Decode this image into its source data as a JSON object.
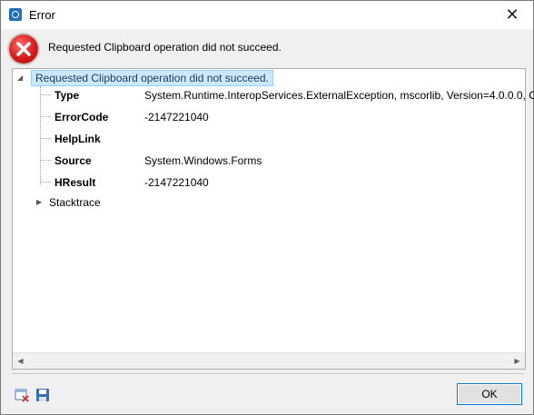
{
  "window": {
    "title": "Error",
    "close_glyph": "✕"
  },
  "error": {
    "icon": "error-icon",
    "message": "Requested Clipboard operation did not succeed."
  },
  "tree": {
    "root_label": "Requested Clipboard operation did not succeed.",
    "properties": [
      {
        "key": "Type",
        "value": "System.Runtime.InteropServices.ExternalException, mscorlib, Version=4.0.0.0, Cultu"
      },
      {
        "key": "ErrorCode",
        "value": "-2147221040"
      },
      {
        "key": "HelpLink",
        "value": ""
      },
      {
        "key": "Source",
        "value": "System.Windows.Forms"
      },
      {
        "key": "HResult",
        "value": "-2147221040"
      }
    ],
    "stacktrace_label": "Stacktrace"
  },
  "footer": {
    "ok_label": "OK",
    "icons": [
      "clear-icon",
      "save-icon"
    ]
  },
  "colors": {
    "selection_bg": "#cce8ff",
    "selection_border": "#99d1ff",
    "accent": "#0078d7"
  }
}
